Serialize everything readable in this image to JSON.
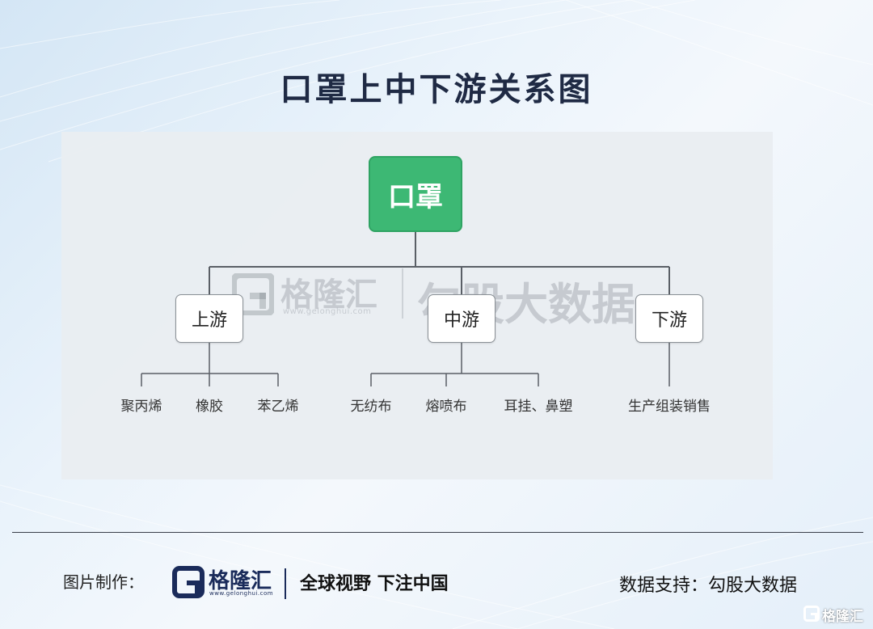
{
  "title": "口罩上中下游关系图",
  "colors": {
    "root_fill": "#3db874",
    "node_border": "#8a9096",
    "line": "#5a5f66",
    "title": "#1f2a44",
    "brand": "#1a2b5a"
  },
  "tree": {
    "root": "口罩",
    "branches": [
      {
        "label": "上游",
        "children": [
          "聚丙烯",
          "橡胶",
          "苯乙烯"
        ]
      },
      {
        "label": "中游",
        "children": [
          "无纺布",
          "熔喷布",
          "耳挂、鼻塑"
        ]
      },
      {
        "label": "下游",
        "children": [
          "生产组装销售"
        ]
      }
    ]
  },
  "watermark": {
    "brand": "格隆汇",
    "url": "www.gelonghui.com",
    "source": "勾股大数据",
    "logo_icon": "gelonghui-logo-icon"
  },
  "footer": {
    "made_by_label": "图片制作：",
    "brand_name": "格隆汇",
    "brand_url": "www.gelonghui.com",
    "slogan": "全球视野 下注中国",
    "data_support": "数据支持：勾股大数据",
    "corner_mark": "格隆汇"
  }
}
